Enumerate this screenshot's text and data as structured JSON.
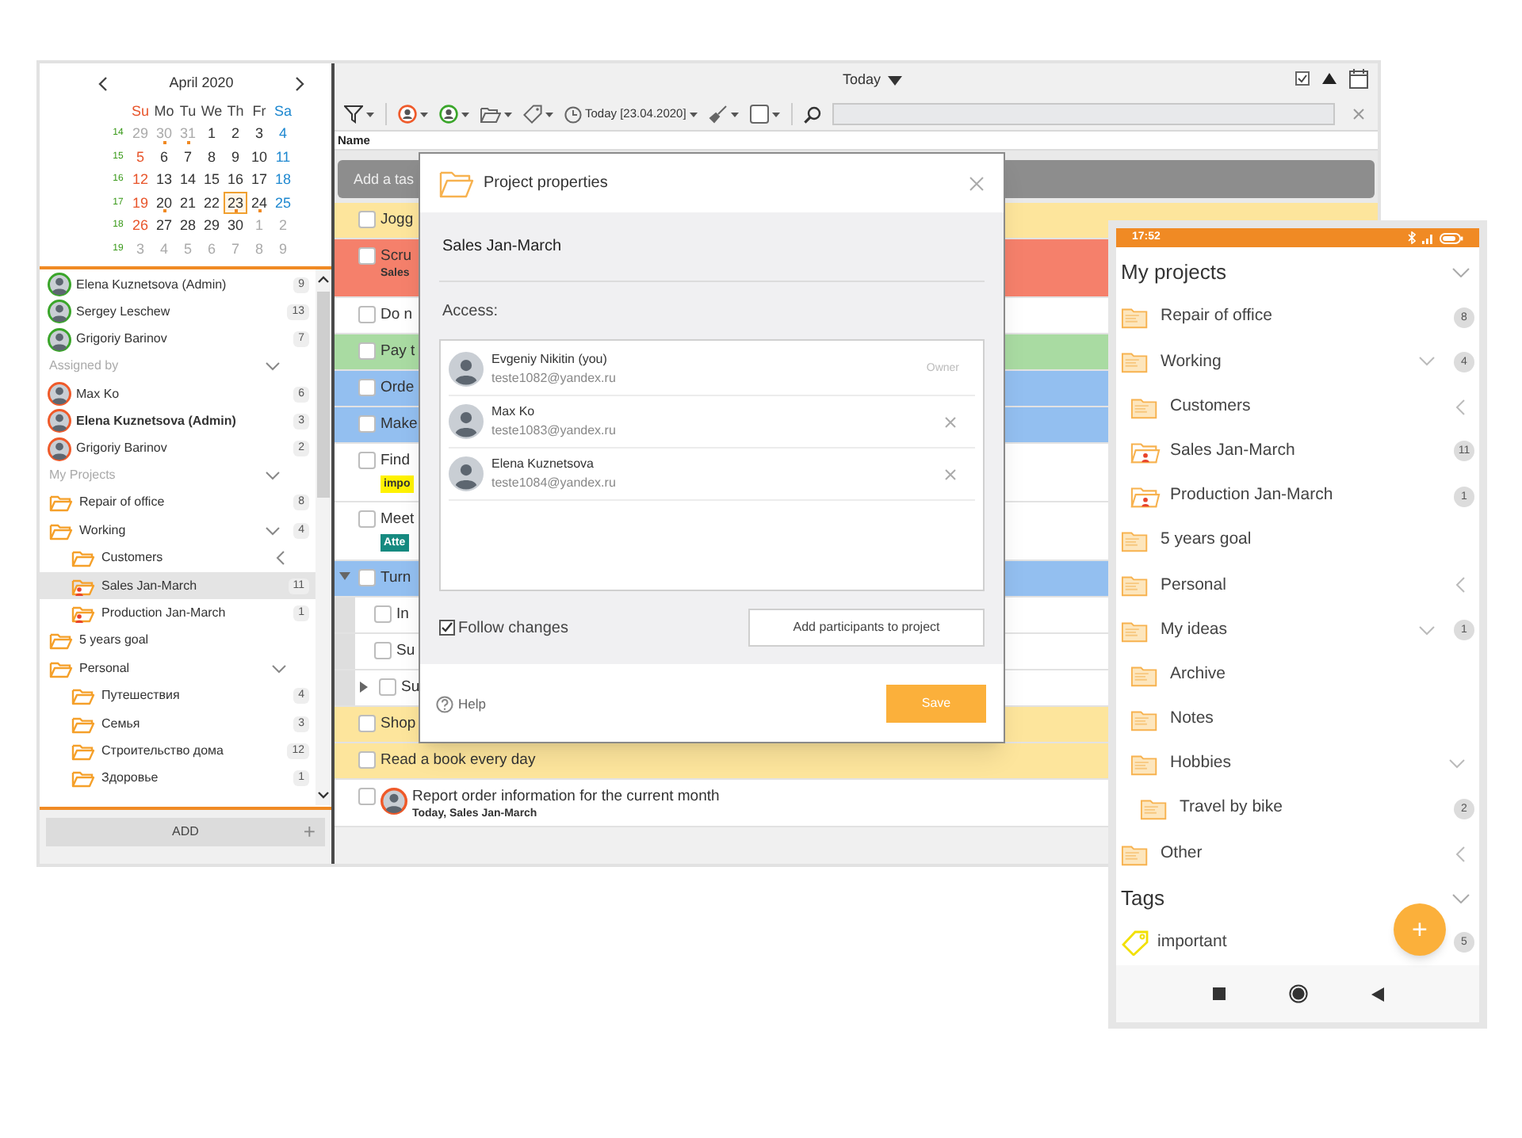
{
  "calendar": {
    "month": "April 2020",
    "weekdays": [
      "Su",
      "Mo",
      "Tu",
      "We",
      "Th",
      "Fr",
      "Sa"
    ],
    "weeks": [
      {
        "number": "14",
        "days": [
          {
            "day": "29",
            "muted": true,
            "dot": false,
            "selected": false
          },
          {
            "day": "30",
            "muted": true,
            "dot": true,
            "selected": false
          },
          {
            "day": "31",
            "muted": true,
            "dot": true,
            "selected": false
          },
          {
            "day": "1",
            "muted": false,
            "dot": false,
            "selected": false
          },
          {
            "day": "2",
            "muted": false,
            "dot": false,
            "selected": false
          },
          {
            "day": "3",
            "muted": false,
            "dot": false,
            "selected": false
          },
          {
            "day": "4",
            "muted": false,
            "dot": false,
            "selected": false
          }
        ]
      },
      {
        "number": "15",
        "days": [
          {
            "day": "5",
            "muted": false,
            "dot": false,
            "selected": false
          },
          {
            "day": "6",
            "muted": false,
            "dot": false,
            "selected": false
          },
          {
            "day": "7",
            "muted": false,
            "dot": false,
            "selected": false
          },
          {
            "day": "8",
            "muted": false,
            "dot": false,
            "selected": false
          },
          {
            "day": "9",
            "muted": false,
            "dot": false,
            "selected": false
          },
          {
            "day": "10",
            "muted": false,
            "dot": false,
            "selected": false
          },
          {
            "day": "11",
            "muted": false,
            "dot": false,
            "selected": false
          }
        ]
      },
      {
        "number": "16",
        "days": [
          {
            "day": "12",
            "muted": false,
            "dot": false,
            "selected": false
          },
          {
            "day": "13",
            "muted": false,
            "dot": false,
            "selected": false
          },
          {
            "day": "14",
            "muted": false,
            "dot": false,
            "selected": false
          },
          {
            "day": "15",
            "muted": false,
            "dot": false,
            "selected": false
          },
          {
            "day": "16",
            "muted": false,
            "dot": false,
            "selected": false
          },
          {
            "day": "17",
            "muted": false,
            "dot": false,
            "selected": false
          },
          {
            "day": "18",
            "muted": false,
            "dot": false,
            "selected": false
          }
        ]
      },
      {
        "number": "17",
        "days": [
          {
            "day": "19",
            "muted": false,
            "dot": false,
            "selected": false
          },
          {
            "day": "20",
            "muted": false,
            "dot": true,
            "selected": false
          },
          {
            "day": "21",
            "muted": false,
            "dot": false,
            "selected": false
          },
          {
            "day": "22",
            "muted": false,
            "dot": false,
            "selected": false
          },
          {
            "day": "23",
            "muted": false,
            "dot": true,
            "selected": true
          },
          {
            "day": "24",
            "muted": false,
            "dot": true,
            "selected": false
          },
          {
            "day": "25",
            "muted": false,
            "dot": false,
            "selected": false
          }
        ]
      },
      {
        "number": "18",
        "days": [
          {
            "day": "26",
            "muted": false,
            "dot": false,
            "selected": false
          },
          {
            "day": "27",
            "muted": false,
            "dot": false,
            "selected": false
          },
          {
            "day": "28",
            "muted": false,
            "dot": false,
            "selected": false
          },
          {
            "day": "29",
            "muted": false,
            "dot": false,
            "selected": false
          },
          {
            "day": "30",
            "muted": false,
            "dot": false,
            "selected": false
          },
          {
            "day": "1",
            "muted": true,
            "dot": false,
            "selected": false
          },
          {
            "day": "2",
            "muted": true,
            "dot": false,
            "selected": false
          }
        ]
      },
      {
        "number": "19",
        "days": [
          {
            "day": "3",
            "muted": true,
            "dot": false,
            "selected": false
          },
          {
            "day": "4",
            "muted": true,
            "dot": false,
            "selected": false
          },
          {
            "day": "5",
            "muted": true,
            "dot": false,
            "selected": false
          },
          {
            "day": "6",
            "muted": true,
            "dot": false,
            "selected": false
          },
          {
            "day": "7",
            "muted": true,
            "dot": false,
            "selected": false
          },
          {
            "day": "8",
            "muted": true,
            "dot": false,
            "selected": false
          },
          {
            "day": "9",
            "muted": true,
            "dot": false,
            "selected": false
          }
        ]
      }
    ]
  },
  "people_groups": [
    {
      "kind": "assignee",
      "items": [
        {
          "name": "Elena Kuznetsova (Admin)",
          "count": "9",
          "bold": false
        },
        {
          "name": "Sergey Leschew",
          "count": "13",
          "bold": false
        },
        {
          "name": "Grigoriy Barinov",
          "count": "7",
          "bold": false
        }
      ]
    },
    {
      "kind": "assigner",
      "title": "Assigned by",
      "expanded": true,
      "items": [
        {
          "name": "Max Ko",
          "count": "6",
          "bold": false
        },
        {
          "name": "Elena Kuznetsova (Admin)",
          "count": "3",
          "bold": true
        },
        {
          "name": "Grigoriy Barinov",
          "count": "2",
          "bold": false
        }
      ]
    }
  ],
  "projects": {
    "title": "My Projects",
    "expanded": true,
    "items": [
      {
        "name": "Repair of office",
        "count": "8",
        "shared": false,
        "selected": false
      },
      {
        "name": "Working",
        "count": "4",
        "expanded": true,
        "shared": false,
        "selected": false,
        "children": [
          {
            "name": "Customers",
            "expanded": false,
            "shared": false,
            "selected": false
          },
          {
            "name": "Sales Jan-March",
            "count": "11",
            "shared": true,
            "selected": true
          },
          {
            "name": "Production Jan-March",
            "count": "1",
            "shared": true,
            "selected": false
          }
        ]
      },
      {
        "name": "5 years goal",
        "shared": false,
        "selected": false
      },
      {
        "name": "Personal",
        "expanded": true,
        "shared": false,
        "selected": false,
        "children": [
          {
            "name": "Путешествия",
            "count": "4",
            "shared": false,
            "selected": false
          },
          {
            "name": "Семья",
            "count": "3",
            "shared": false,
            "selected": false
          },
          {
            "name": "Строительство дома",
            "count": "12",
            "shared": false,
            "selected": false
          },
          {
            "name": "Здоровье",
            "count": "1",
            "shared": false,
            "selected": false
          }
        ]
      }
    ]
  },
  "add_button": {
    "label": "ADD",
    "icon": "+"
  },
  "view_title": "Today",
  "toolbar": {
    "date_filter": "Today [23.04.2020]"
  },
  "column_header": "Name",
  "add_task": {
    "placeholder": "Add a tas"
  },
  "tasks": [
    {
      "title": "Jogg",
      "color": "#fde59c",
      "checked": false
    },
    {
      "title": "Scru",
      "sub": "Sales",
      "color": "#f5806b",
      "checked": false
    },
    {
      "title": "Do n",
      "color": "#ffffff",
      "checked": false
    },
    {
      "title": "Pay t",
      "color": "#a9dba2",
      "checked": false
    },
    {
      "title": "Orde",
      "color": "#93bff0",
      "checked": false
    },
    {
      "title": "Make",
      "color": "#93bff0",
      "checked": false
    },
    {
      "title": "Find",
      "tag": {
        "label": "impo",
        "color": "#fff200"
      },
      "color": "#ffffff",
      "checked": false
    },
    {
      "title": "Meet",
      "tag": {
        "label": "Atte",
        "color": "#168a80"
      },
      "color": "#ffffff",
      "checked": false
    },
    {
      "title": "Turn",
      "color": "#93bff0",
      "checked": false,
      "expanded": true,
      "children": [
        {
          "title": "In",
          "color": "#ffffff",
          "checked": false
        },
        {
          "title": "Su",
          "color": "#ffffff",
          "checked": false
        },
        {
          "title": "Su",
          "color": "#ffffff",
          "checked": false,
          "expanded": false
        }
      ]
    },
    {
      "title": "Shop",
      "color": "#fde59c",
      "checked": false
    },
    {
      "title": "Read a book every day",
      "color": "#fde59c",
      "checked": false
    },
    {
      "title": "Report order information for the current month",
      "sub": "Today, Sales Jan-March",
      "assignee": true,
      "color": "#ffffff",
      "checked": false
    }
  ],
  "dialog": {
    "title": "Project properties",
    "project_name": "Sales Jan-March",
    "access_label": "Access:",
    "participants": [
      {
        "name": "Evgeniy Nikitin (you)",
        "email": "teste1082@yandex.ru",
        "role": "Owner"
      },
      {
        "name": "Max Ko",
        "email": "teste1083@yandex.ru"
      },
      {
        "name": "Elena Kuznetsova",
        "email": "teste1084@yandex.ru"
      }
    ],
    "follow_changes": {
      "label": "Follow changes",
      "checked": true
    },
    "add_participants": "Add participants to project",
    "help": "Help",
    "save": "Save"
  },
  "phone": {
    "time": "17:52",
    "projects": {
      "title": "My projects",
      "expanded": true,
      "items": [
        {
          "name": "Repair of office",
          "count": "8",
          "shared": false
        },
        {
          "name": "Working",
          "count": "4",
          "expanded": true,
          "shared": false,
          "children": [
            {
              "name": "Customers",
              "expanded": false,
              "shared": false
            },
            {
              "name": "Sales Jan-March",
              "count": "11",
              "shared": true
            },
            {
              "name": "Production Jan-March",
              "count": "1",
              "shared": true
            }
          ]
        },
        {
          "name": "5 years goal",
          "shared": false
        },
        {
          "name": "Personal",
          "expanded": false,
          "shared": false
        },
        {
          "name": "My ideas",
          "count": "1",
          "expanded": true,
          "shared": false,
          "children": [
            {
              "name": "Archive",
              "shared": false
            },
            {
              "name": "Notes",
              "shared": false
            },
            {
              "name": "Hobbies",
              "expanded": true,
              "shared": false,
              "children": [
                {
                  "name": "Travel by bike",
                  "count": "2",
                  "shared": false
                }
              ]
            }
          ]
        },
        {
          "name": "Other",
          "expanded": false,
          "shared": false
        }
      ]
    },
    "tags": {
      "title": "Tags",
      "expanded": true,
      "items": [
        {
          "name": "important",
          "count": "5"
        }
      ]
    },
    "fab": "+"
  }
}
